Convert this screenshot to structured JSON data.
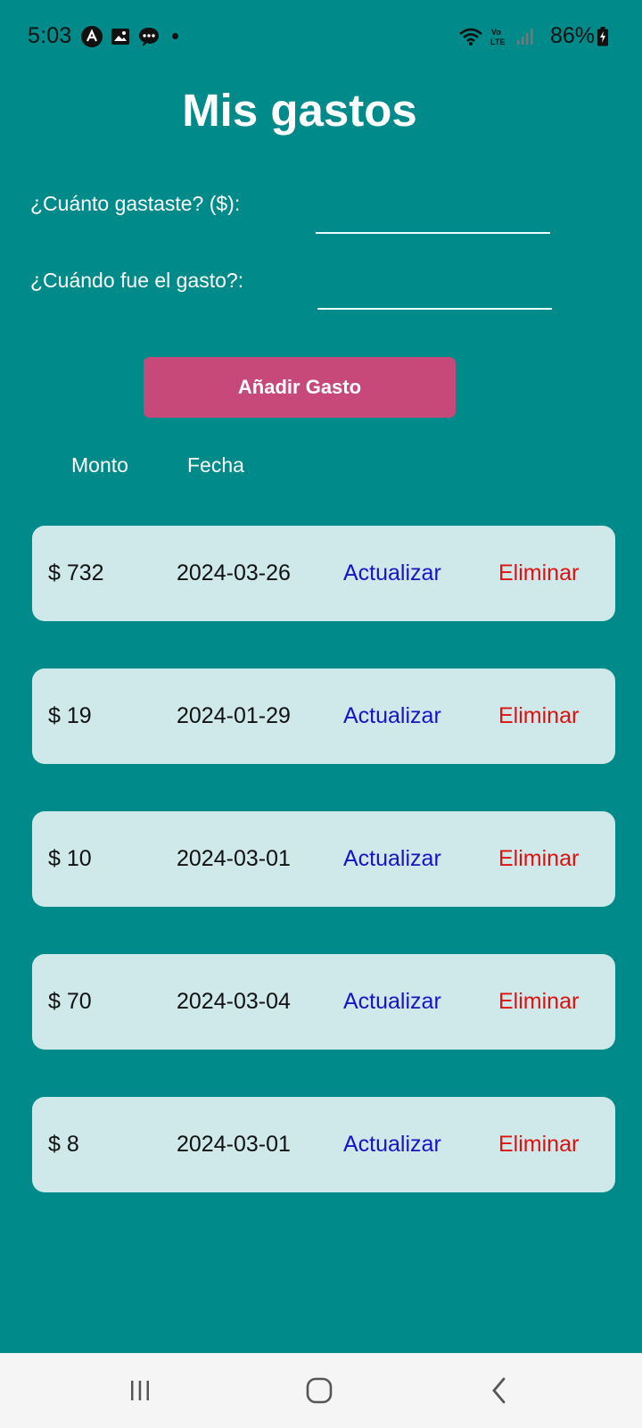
{
  "status_bar": {
    "time": "5:03",
    "battery": "86%",
    "icons": [
      "app-notification-icon",
      "image-icon",
      "chat-icon",
      "dot-icon",
      "wifi-icon",
      "volte-icon",
      "signal-icon",
      "battery-charging-icon"
    ]
  },
  "header": {
    "title": "Mis gastos"
  },
  "form": {
    "amount_label": "¿Cuánto gastaste? ($):",
    "amount_value": "",
    "date_label": "¿Cuándo fue el gasto?:",
    "date_value": "",
    "add_button_label": "Añadir Gasto"
  },
  "table": {
    "columns": [
      "Monto",
      "Fecha"
    ],
    "rows": [
      {
        "amount": "$ 732",
        "date": "2024-03-26",
        "update_label": "Actualizar",
        "delete_label": "Eliminar"
      },
      {
        "amount": "$ 19",
        "date": "2024-01-29",
        "update_label": "Actualizar",
        "delete_label": "Eliminar"
      },
      {
        "amount": "$ 10",
        "date": "2024-03-01",
        "update_label": "Actualizar",
        "delete_label": "Eliminar"
      },
      {
        "amount": "$ 70",
        "date": "2024-03-04",
        "update_label": "Actualizar",
        "delete_label": "Eliminar"
      },
      {
        "amount": "$ 8",
        "date": "2024-03-01",
        "update_label": "Actualizar",
        "delete_label": "Eliminar"
      }
    ]
  },
  "colors": {
    "background": "#008a89",
    "row_background": "#cfe8e9",
    "button": "#c7497a",
    "update_link": "#1414c8",
    "delete_link": "#e01010"
  },
  "nav_bar": {
    "icons": [
      "recent-apps-icon",
      "home-icon",
      "back-icon"
    ]
  }
}
